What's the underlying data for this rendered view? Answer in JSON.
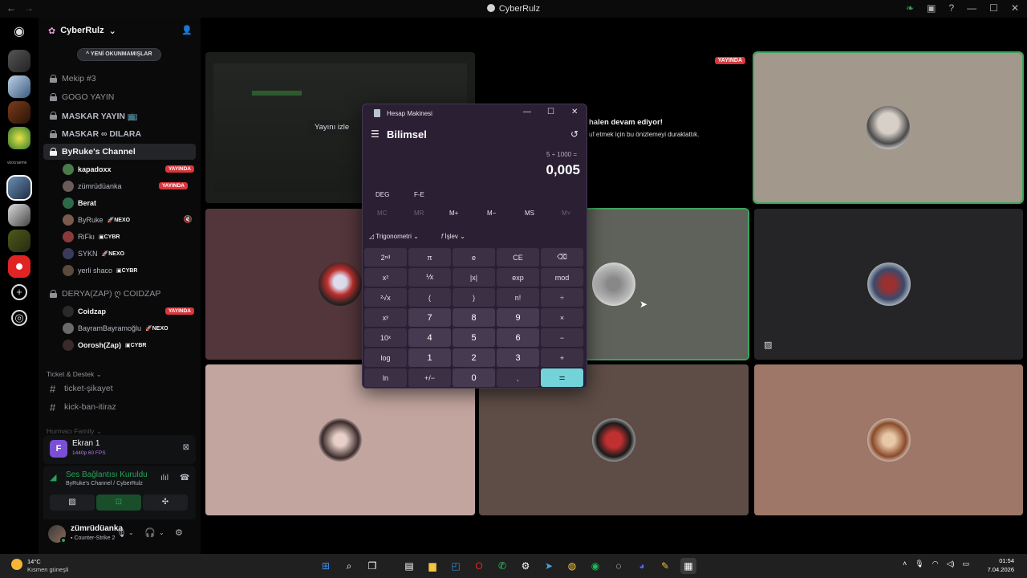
{
  "window": {
    "title": "CyberRulz"
  },
  "server": {
    "name": "CyberRulz",
    "unread_pill": "^ YENİ OKUNMAMIŞLAR"
  },
  "rail": {
    "small_label": "vkocraeme"
  },
  "channels": [
    {
      "name": "Mekip #3"
    },
    {
      "name": "GOGO YAYIN"
    },
    {
      "name": "MASKAR YAYIN 📺"
    },
    {
      "name": "MASKAR ∞ DILARA"
    },
    {
      "name": "ByRuke's Channel"
    }
  ],
  "byruke_users": [
    {
      "name": "kapadoxx",
      "badge": "YAYINDA"
    },
    {
      "name": "zümrüdüanka",
      "badge": "YAYINDA"
    },
    {
      "name": "Berat",
      "badge": ""
    },
    {
      "name": "ByRuke",
      "tag": "NEXO"
    },
    {
      "name": "RiFkı",
      "tag": "CYBR"
    },
    {
      "name": "SYKN",
      "tag": "NEXO"
    },
    {
      "name": "yerli shaco",
      "tag": "CYBR"
    }
  ],
  "derya_channel": {
    "name": "DERYA(ZAP) ღ COIDZAP"
  },
  "derya_users": [
    {
      "name": "Coidzap",
      "badge": "YAYINDA"
    },
    {
      "name": "BayramBayramoğlu",
      "tag": "NEXO"
    },
    {
      "name": "Oorosh(Zap)",
      "tag": "CYBR"
    }
  ],
  "category": {
    "name": "Ticket & Destek"
  },
  "text_channels": [
    {
      "name": "ticket-şikayet"
    },
    {
      "name": "kick-ban-itiraz"
    }
  ],
  "next_category": "Hurmacı Family",
  "stream_panel": {
    "title": "Ekran 1",
    "quality": "1440p 60 FPS"
  },
  "voice_panel": {
    "status": "Ses Bağlantısı Kuruldu",
    "location": "ByRuke's Channel / CyberRulz"
  },
  "user_panel": {
    "name": "zümrüdüanka",
    "activity": "Counter-Strike 2"
  },
  "stage": {
    "live_badge": "YAYINDA",
    "watch_label": "Yayını izle",
    "paused_title": "halen devam ediyor!",
    "paused_sub": "uf etmek için bu önizlemeyi duraklattık."
  },
  "calculator": {
    "app_title": "Hesap Makinesi",
    "mode": "Bilimsel",
    "expression": "5 ÷ 1000 =",
    "result": "0,005",
    "angle": "DEG",
    "fe": "F-E",
    "memory": [
      "MC",
      "MR",
      "M+",
      "M−",
      "MS",
      "M˅"
    ],
    "trig": "Trigonometri",
    "func": "İşlev",
    "keys": [
      "2ⁿᵈ",
      "π",
      "e",
      "CE",
      "⌫",
      "x²",
      "⅟x",
      "|x|",
      "exp",
      "mod",
      "²√x",
      "(",
      ")",
      "n!",
      "÷",
      "xʸ",
      "7",
      "8",
      "9",
      "×",
      "10ˣ",
      "4",
      "5",
      "6",
      "−",
      "log",
      "1",
      "2",
      "3",
      "+",
      "ln",
      "+/−",
      "0",
      ",",
      "="
    ]
  },
  "taskbar": {
    "temp": "14°C",
    "weather": "Kısmen güneşli",
    "time": "01:54",
    "date": "7.04.2026"
  }
}
